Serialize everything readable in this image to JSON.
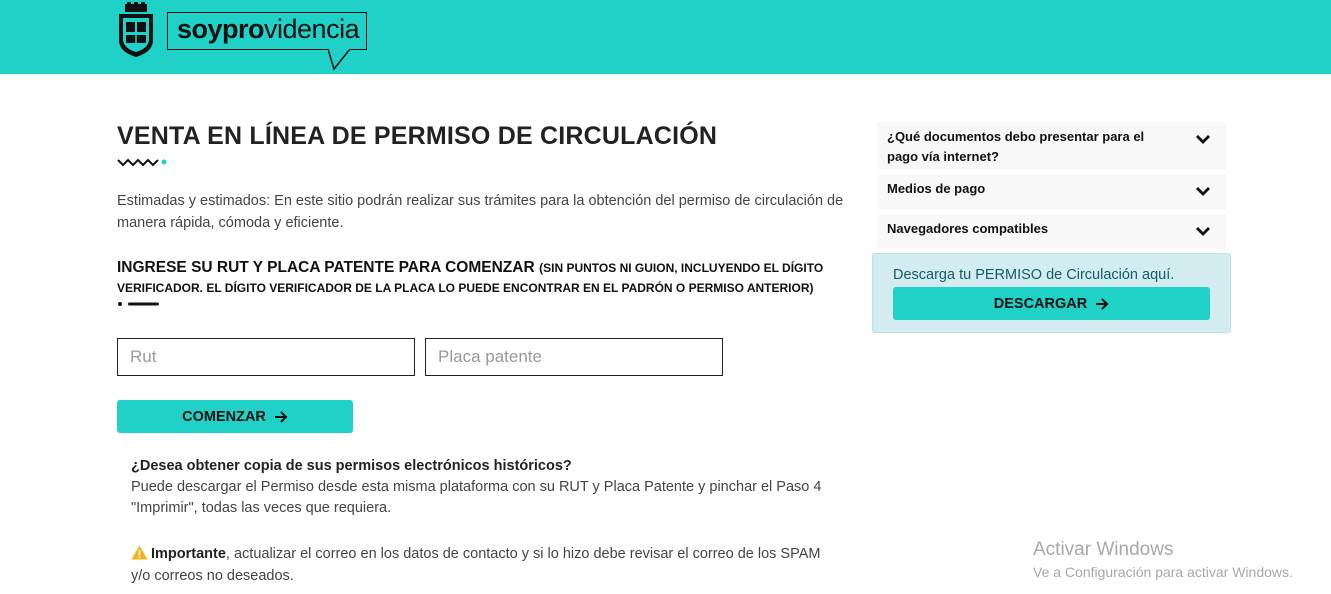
{
  "header": {
    "logo_bold": "soypro",
    "logo_light": "videncia",
    "crest_icon": "municipal-crest-icon",
    "bg_color": "#1fd1c6"
  },
  "main": {
    "title": "VENTA EN LÍNEA DE PERMISO DE CIRCULACIÓN",
    "intro": "Estimadas y estimados: En este sitio podrán realizar sus trámites para la obtención del permiso de circulación de manera rápida, cómoda y eficiente.",
    "section_title": "INGRESE SU RUT Y PLACA PATENTE PARA COMENZAR",
    "section_note": "(SIN PUNTOS NI GUION, INCLUYENDO EL DÍGITO VERIFICADOR. EL DÍGITO VERIFICADOR DE LA PLACA LO PUEDE ENCONTRAR EN EL PADRÓN O PERMISO ANTERIOR)",
    "rut_placeholder": "Rut",
    "placa_placeholder": "Placa patente",
    "start_button": "COMENZAR",
    "history_question": "¿Desea obtener copia de sus permisos electrónicos históricos?",
    "history_text": "Puede descargar el Permiso desde esta misma plataforma con su RUT y Placa Patente y pinchar el Paso 4 \"Imprimir\", todas las veces que requiera.",
    "warning_label": "Importante",
    "warning_text": ", actualizar el correo en los datos de contacto y si lo hizo debe revisar el correo de los SPAM y/o correos no deseados."
  },
  "sidebar": {
    "accordion": [
      {
        "label": "¿Qué documentos debo presentar para el pago vía internet?"
      },
      {
        "label": "Medios de pago"
      },
      {
        "label": "Navegadores compatibles"
      }
    ],
    "download_text": "Descarga tu PERMISO de Circulación aquí.",
    "download_button": "DESCARGAR"
  },
  "watermark": {
    "title": "Activar Windows",
    "subtitle": "Ve a Configuración para activar Windows."
  },
  "colors": {
    "accent": "#1fd1c6",
    "download_box": "#d2ecf0",
    "warning": "#f2b31c"
  }
}
